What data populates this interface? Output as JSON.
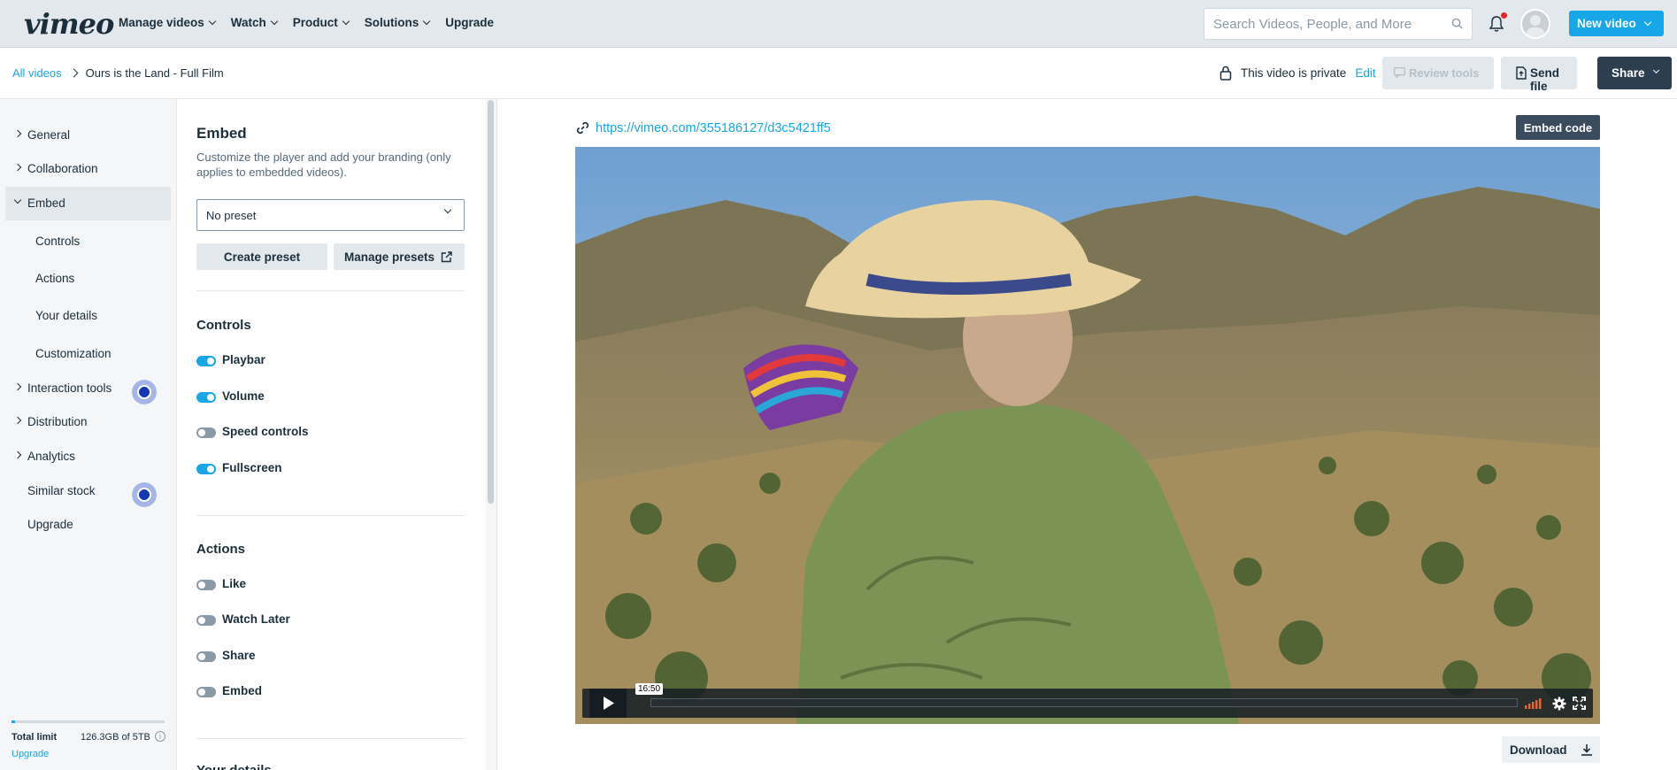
{
  "nav": {
    "logo": "vimeo",
    "menu": [
      "Manage videos",
      "Watch",
      "Product",
      "Solutions"
    ],
    "upgrade": "Upgrade",
    "search_placeholder": "Search Videos, People, and More",
    "new_video": "New video"
  },
  "subbar": {
    "all_videos": "All videos",
    "video_title": "Ours is the Land - Full Film",
    "privacy_text": "This video is private",
    "edit": "Edit",
    "review_tools": "Review tools",
    "send_file": "Send file",
    "share": "Share"
  },
  "sidebar": {
    "items": [
      "General",
      "Collaboration",
      "Embed"
    ],
    "embed_sub": [
      "Controls",
      "Actions",
      "Your details",
      "Customization"
    ],
    "items2": [
      "Interaction tools",
      "Distribution",
      "Analytics",
      "Similar stock",
      "Upgrade"
    ],
    "storage_label": "Total limit",
    "storage_value": "126.3GB of 5TB",
    "storage_upgrade": "Upgrade",
    "storage_fraction": 0.025
  },
  "panel": {
    "title": "Embed",
    "description": "Customize the player and add your branding (only applies to embedded videos).",
    "preset": "No preset",
    "create_preset": "Create preset",
    "manage_presets": "Manage presets",
    "controls_title": "Controls",
    "controls": [
      {
        "label": "Playbar",
        "on": true
      },
      {
        "label": "Volume",
        "on": true
      },
      {
        "label": "Speed controls",
        "on": false
      },
      {
        "label": "Fullscreen",
        "on": true
      }
    ],
    "actions_title": "Actions",
    "actions": [
      {
        "label": "Like",
        "on": false
      },
      {
        "label": "Watch Later",
        "on": false
      },
      {
        "label": "Share",
        "on": false
      },
      {
        "label": "Embed",
        "on": false
      }
    ],
    "next_section": "Your details"
  },
  "main": {
    "url": "https://vimeo.com/355186127/d3c5421ff5",
    "embed_code": "Embed code",
    "time": "16:50",
    "download": "Download"
  },
  "colors": {
    "accent": "#17a6e8",
    "dark": "#1a2e3b",
    "share_bg": "#2c3e50"
  }
}
